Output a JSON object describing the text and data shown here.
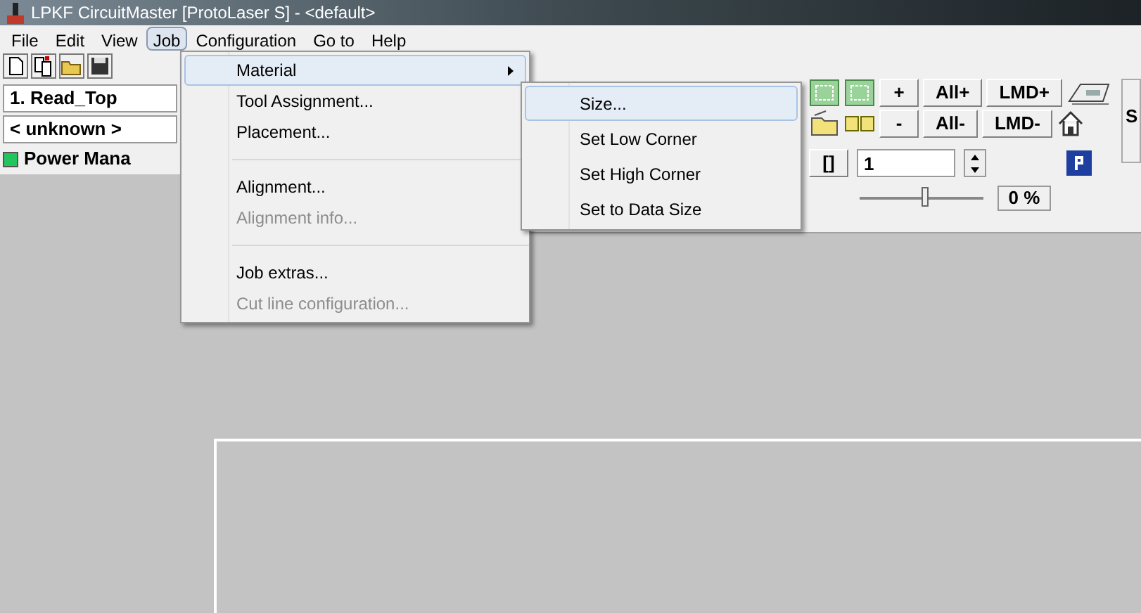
{
  "window": {
    "title": "LPKF CircuitMaster [ProtoLaser S] - <default>"
  },
  "menu_bar": [
    {
      "label": "File",
      "selected": false
    },
    {
      "label": "Edit",
      "selected": false
    },
    {
      "label": "View",
      "selected": false
    },
    {
      "label": "Job",
      "selected": true
    },
    {
      "label": "Configuration",
      "selected": false
    },
    {
      "label": "Go to",
      "selected": false
    },
    {
      "label": "Help",
      "selected": false
    }
  ],
  "left_panel": {
    "phase": "1. Read_Top",
    "tool": "< unknown >",
    "power": {
      "label": "Power Mana",
      "color": "#22c55e"
    }
  },
  "toolbar_rows": [
    [
      {
        "kind": "board"
      },
      {
        "kind": "board"
      },
      {
        "kind": "text",
        "label": "+"
      },
      {
        "kind": "text",
        "label": "All+"
      },
      {
        "kind": "text",
        "label": "LMD+"
      },
      {
        "kind": "scanner"
      }
    ],
    [
      {
        "kind": "folder"
      },
      {
        "kind": "numbers"
      },
      {
        "kind": "text",
        "label": "-"
      },
      {
        "kind": "text",
        "label": "All-"
      },
      {
        "kind": "text",
        "label": "LMD-"
      },
      {
        "kind": "house"
      }
    ]
  ],
  "count": {
    "bracket_label": "[]",
    "value": "1"
  },
  "slider": {
    "level": 0.53,
    "reading": "0 %"
  },
  "side_panel": {
    "text": "S"
  },
  "job_menu": [
    {
      "kind": "item",
      "label": "Material",
      "disabled": false,
      "submenu": true,
      "selected": true
    },
    {
      "kind": "item",
      "label": "Tool Assignment...",
      "disabled": false,
      "submenu": false,
      "selected": false
    },
    {
      "kind": "item",
      "label": "Placement...",
      "disabled": false,
      "submenu": false,
      "selected": false
    },
    {
      "kind": "separator"
    },
    {
      "kind": "item",
      "label": "Alignment...",
      "disabled": false,
      "submenu": false,
      "selected": false
    },
    {
      "kind": "item",
      "label": "Alignment info...",
      "disabled": true,
      "submenu": false,
      "selected": false
    },
    {
      "kind": "separator"
    },
    {
      "kind": "item",
      "label": "Job extras...",
      "disabled": false,
      "submenu": false,
      "selected": false
    },
    {
      "kind": "item",
      "label": "Cut line configuration...",
      "disabled": true,
      "submenu": false,
      "selected": false
    }
  ],
  "material_submenu": [
    {
      "label": "Size...",
      "selected": true
    },
    {
      "label": "Set Low Corner",
      "selected": false
    },
    {
      "label": "Set High Corner",
      "selected": false
    },
    {
      "label": "Set to Data Size",
      "selected": false
    }
  ]
}
